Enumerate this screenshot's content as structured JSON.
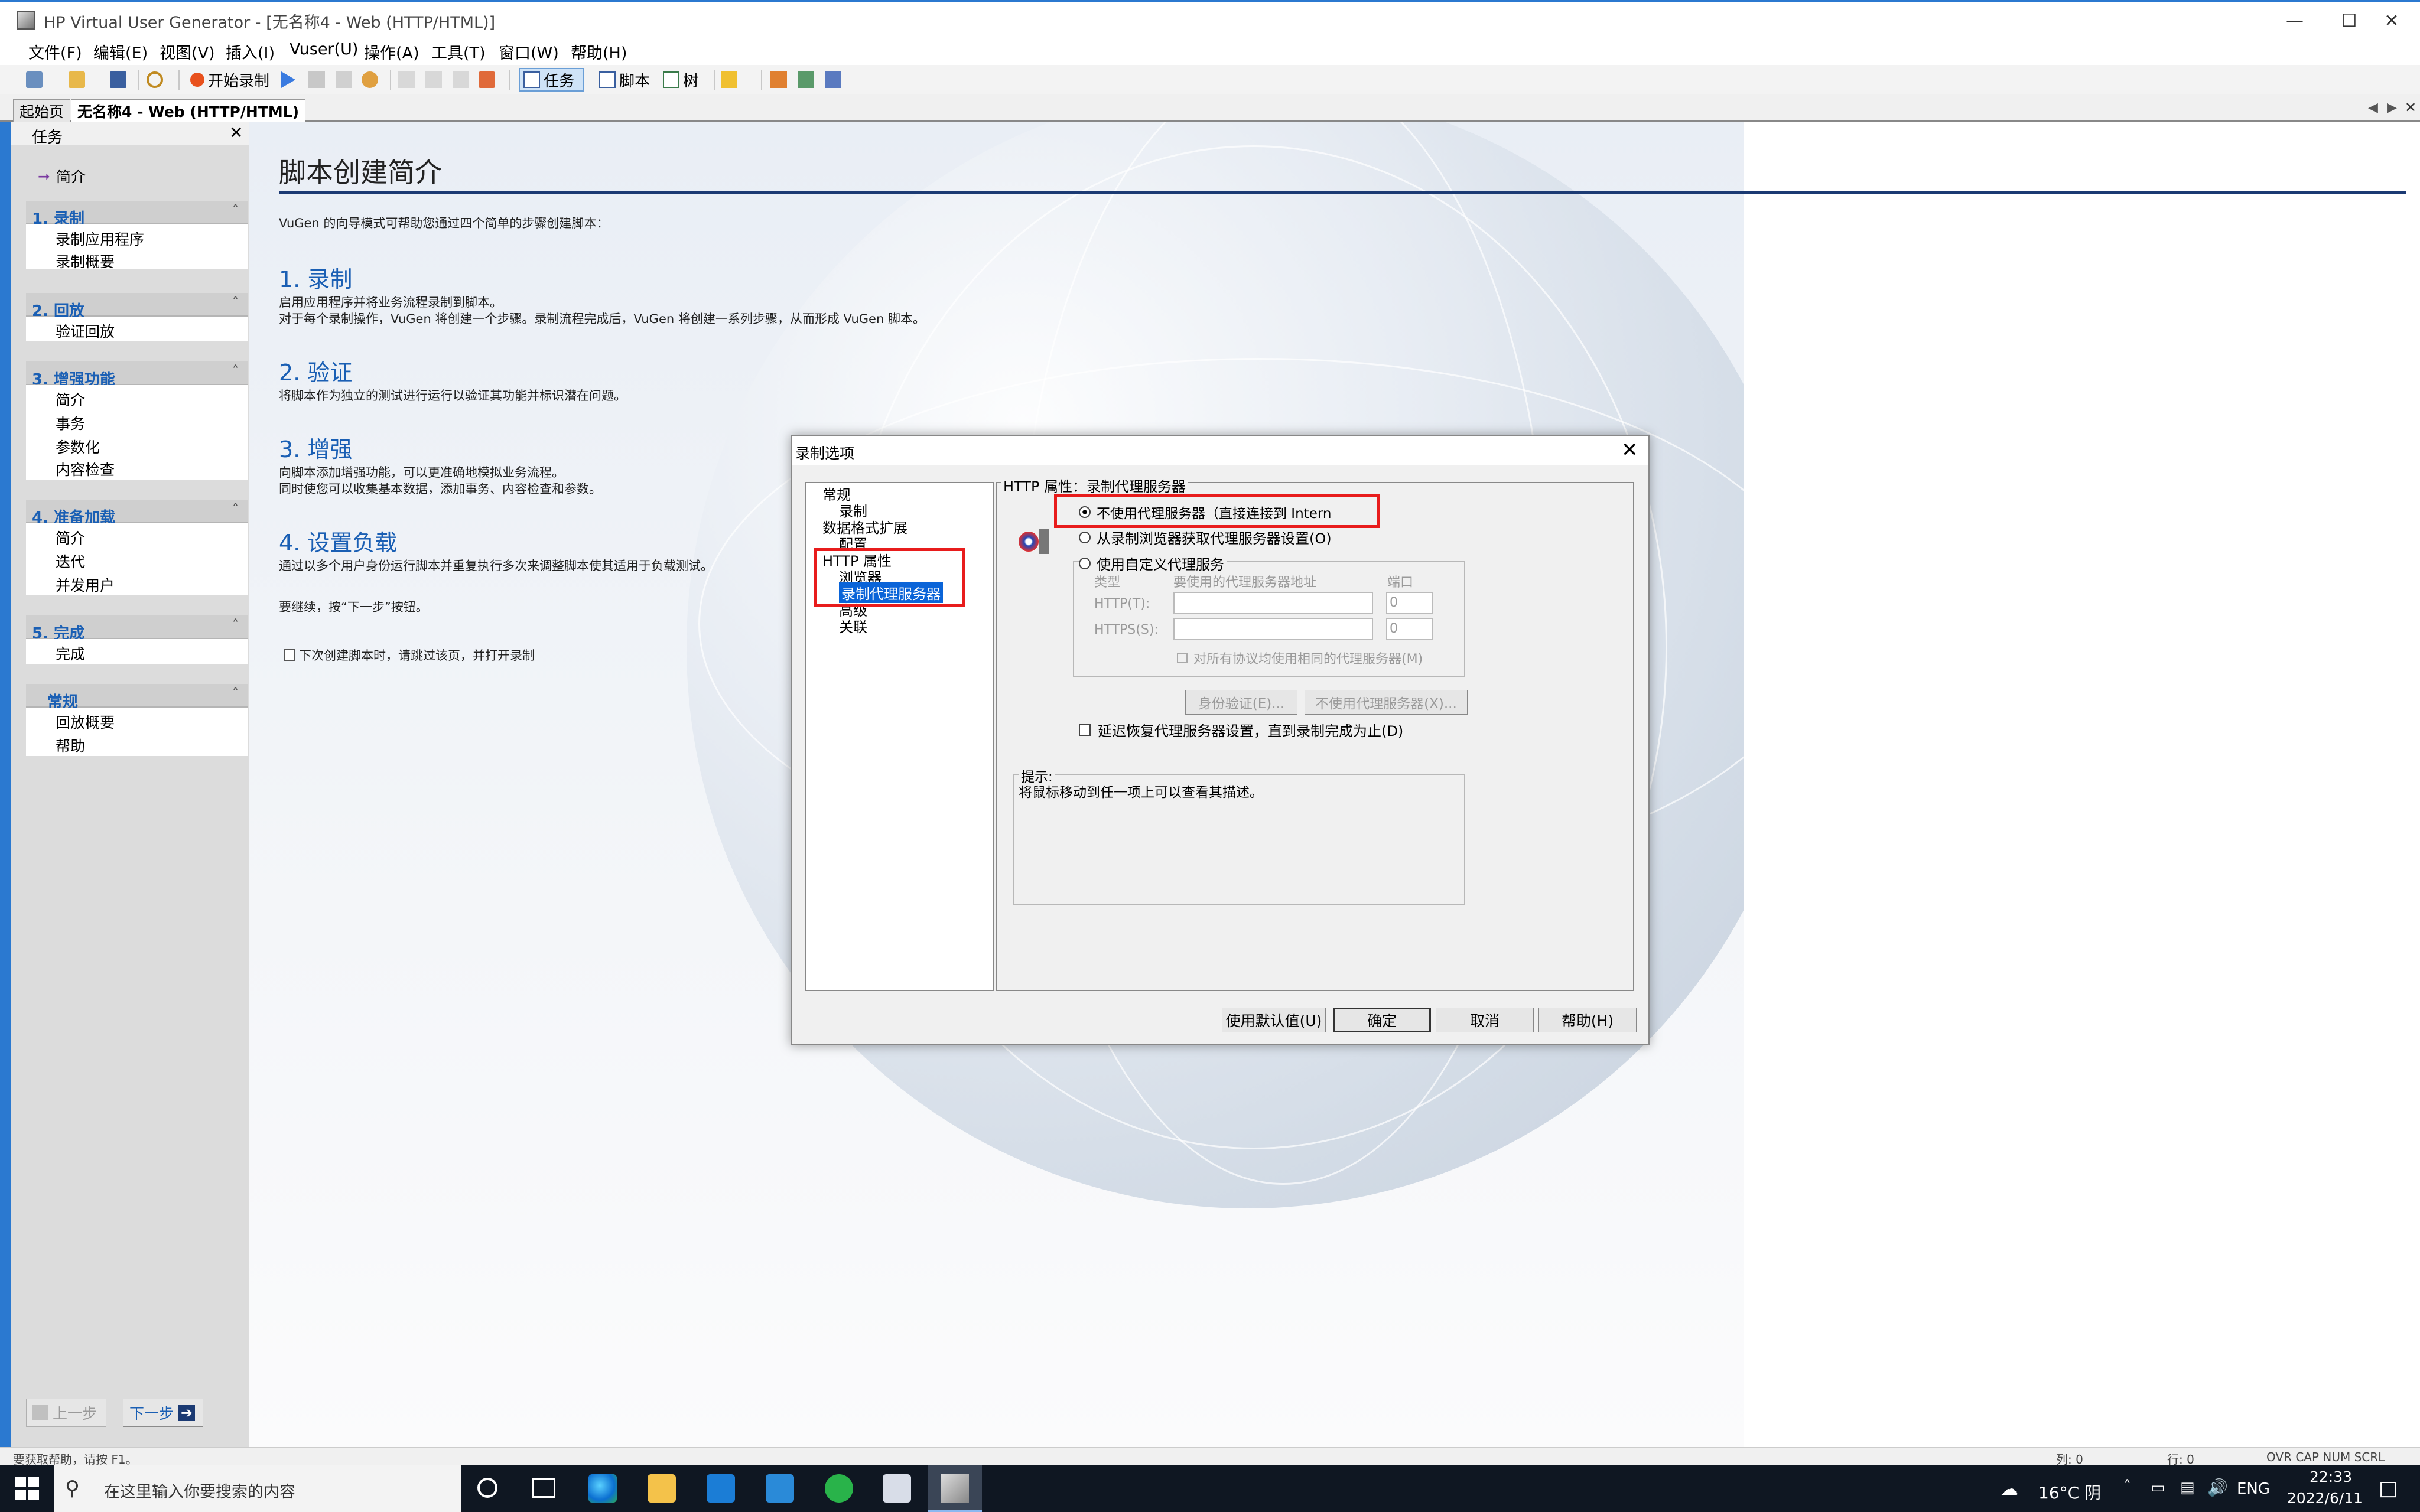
{
  "window": {
    "title": "HP Virtual User Generator - [无名称4 - Web (HTTP/HTML)]"
  },
  "menu": [
    "文件(F)",
    "编辑(E)",
    "视图(V)",
    "插入(I)",
    "Vuser(U)",
    "操作(A)",
    "工具(T)",
    "窗口(W)",
    "帮助(H)"
  ],
  "toolbar": {
    "record": "开始录制",
    "tasks": "任务",
    "script": "脚本",
    "tree": "树"
  },
  "tabs": [
    "起始页",
    "无名称4 - Web (HTTP/HTML)"
  ],
  "taskpane": {
    "title": "任务",
    "intro": "简介",
    "sections": [
      {
        "title": "1. 录制",
        "items": [
          "录制应用程序",
          "录制概要"
        ]
      },
      {
        "title": "2. 回放",
        "items": [
          "验证回放"
        ]
      },
      {
        "title": "3. 增强功能",
        "items": [
          "简介",
          "事务",
          "参数化",
          "内容检查"
        ]
      },
      {
        "title": "4. 准备加载",
        "items": [
          "简介",
          "迭代",
          "并发用户"
        ]
      },
      {
        "title": "5. 完成",
        "items": [
          "完成"
        ]
      },
      {
        "title": "常规",
        "items": [
          "回放概要",
          "帮助"
        ]
      }
    ],
    "prev": "上一步",
    "next": "下一步"
  },
  "main": {
    "title": "脚本创建简介",
    "intro": "VuGen 的向导模式可帮助您通过四个简单的步骤创建脚本：",
    "steps": [
      {
        "title": "1. 录制",
        "lines": [
          "启用应用程序并将业务流程录制到脚本。",
          "对于每个录制操作，VuGen 将创建一个步骤。录制流程完成后，VuGen 将创建一系列步骤，从而形成 VuGen 脚本。"
        ]
      },
      {
        "title": "2. 验证",
        "lines": [
          "将脚本作为独立的测试进行运行以验证其功能并标识潜在问题。"
        ]
      },
      {
        "title": "3. 增强",
        "lines": [
          "向脚本添加增强功能，可以更准确地模拟业务流程。",
          "同时使您可以收集基本数据，添加事务、内容检查和参数。"
        ]
      },
      {
        "title": "4. 设置负载",
        "lines": [
          "通过以多个用户身份运行脚本并重复执行多次来调整脚本使其适用于负载测试。"
        ]
      }
    ],
    "continue": "要继续，按“下一步”按钮。",
    "skip_checkbox": "下次创建脚本时，请跳过该页，并打开录制"
  },
  "dialog": {
    "title": "录制选项",
    "tree": [
      "常规",
      "录制",
      "数据格式扩展",
      "配置",
      "HTTP 属性",
      "浏览器",
      "录制代理服务器",
      "高级",
      "关联"
    ],
    "group_title": "HTTP 属性：录制代理服务器",
    "radio_no_proxy": "不使用代理服务器（直接连接到 Intern",
    "radio_browser": "从录制浏览器获取代理服务器设置(O)",
    "radio_custom": "使用自定义代理服务",
    "col_type": "类型",
    "col_addr": "要使用的代理服务器地址",
    "col_port": "端口",
    "http_label": "HTTP(T):",
    "https_label": "HTTPS(S):",
    "port_http": "0",
    "port_https": "0",
    "same_proxy": "对所有协议均使用相同的代理服务器(M)",
    "auth_btn": "身份验证(E)...",
    "noproxy_btn": "不使用代理服务器(X)...",
    "delay_restore": "延迟恢复代理服务器设置，直到录制完成为止(D)",
    "hint_title": "提示:",
    "hint_text": "将鼠标移动到任一项上可以查看其描述。",
    "buttons": {
      "defaults": "使用默认值(U)",
      "ok": "确定",
      "cancel": "取消",
      "help": "帮助(H)"
    }
  },
  "statusbar": {
    "left": "要获取帮助，请按 F1。",
    "col": "列: 0",
    "row": "行: 0",
    "keys": "OVR CAP NUM SCRL"
  },
  "taskbar": {
    "search_placeholder": "在这里输入你要搜索的内容",
    "weather": "16°C 阴",
    "lang": "ENG",
    "time": "22:33",
    "date": "2022/6/11"
  }
}
